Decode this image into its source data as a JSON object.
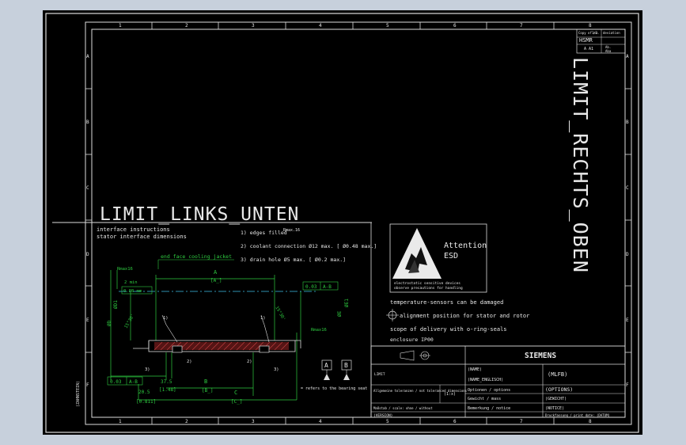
{
  "labels": {
    "limit_links_unten": "LIMIT_LINKS_UNTEN",
    "limit_rechts_oben": "LIMIT_RECHTS_OBEN",
    "interface_instructions": "interface instructions",
    "stator_interface_dimensions": "stator interface dimensions",
    "note_1": "1) edges filled",
    "note_1_dim": "Rmax.16",
    "note_2": "2) coolant connection Ø12 max. [ Ø0.48 max.]",
    "note_3": "3) drain hole Ø5 max. [ Ø0.2 max.]",
    "end_face_cooling_jacket": "end face cooling jacket",
    "attention": "Attention",
    "esd": "ESD",
    "esd_small_1": "electrostatic sensitive devices",
    "esd_small_2": "observe precautions for handling",
    "temperature_sensors": "temperature-sensors can be damaged",
    "alignment": "alignment position for stator and rotor",
    "scope": "scope of delivery with o-ring-seals",
    "enclosure": "enclosure IP00",
    "refers_bearing_seat": "= refers to the bearing seat",
    "left_vertical": "(ZAHNSTEIN)"
  },
  "dimensions": {
    "rmax16_top": "Rmax16",
    "two_min": "2 min",
    "tol_008": "0.08 mm",
    "A": "A",
    "A_bracket": "[A_]",
    "tol_003": "0.03",
    "ref_AB": "A-B",
    "phi_D": "ØD",
    "phi_D1": "ØD1",
    "phi_E": "ØE",
    "phi_E1": "ØE1",
    "angle_15_30": "15°30'",
    "rmax16_right": "Rmax16",
    "dim_1": "1)",
    "dim_2": "2)",
    "dim_3": "3)",
    "dim_375": "37.5",
    "dim_148": "[1.48]",
    "dim_205": "20.5",
    "dim_0811": "[0.811]",
    "B": "B",
    "B_bracket": "[B_]",
    "C": "C",
    "C_bracket": "[C_]",
    "datum_A": "A",
    "datum_B": "B"
  },
  "grid": {
    "top_cols": [
      "1",
      "2",
      "3",
      "4",
      "5",
      "6",
      "7",
      "8"
    ],
    "bottom_cols": [
      "1",
      "2",
      "3",
      "4",
      "5",
      "6",
      "7",
      "8"
    ],
    "left_rows": [
      "A",
      "B",
      "C",
      "D",
      "E",
      "F"
    ],
    "right_rows": [
      "A",
      "B",
      "C",
      "D",
      "E",
      "F"
    ]
  },
  "top_right_box": {
    "r1c1": "Copy of no.",
    "r1c2": "1/1",
    "r1c3": "deviation",
    "r2c1": "HSMR",
    "r3c1": "A A1",
    "r3c2": "Ab.",
    "r3c3": "Aba"
  },
  "title_block": {
    "siemens": "SIEMENS",
    "name": "(NAME)",
    "name_english": "(NAME_ENGLISCH)",
    "mlfb": "(MLFB)",
    "options_label": "Optionen / options",
    "options": "(OPTIONS)",
    "weight_label": "Gewicht / mass",
    "weight": "(GEWICHT)",
    "remarks_label": "Bemerkung / notice",
    "remarks": "(NOTICE)",
    "limit_cell": "LIMIT",
    "general_tolerance": "Allgemeine toleranzen / not toleranced dimensions",
    "scale_label": "Maßstab / scale: ohne / without",
    "version": "(VERSION)",
    "iso_ref": "(1:x)",
    "doc_cell": "Druckfassung / print date: (DATUM)"
  }
}
